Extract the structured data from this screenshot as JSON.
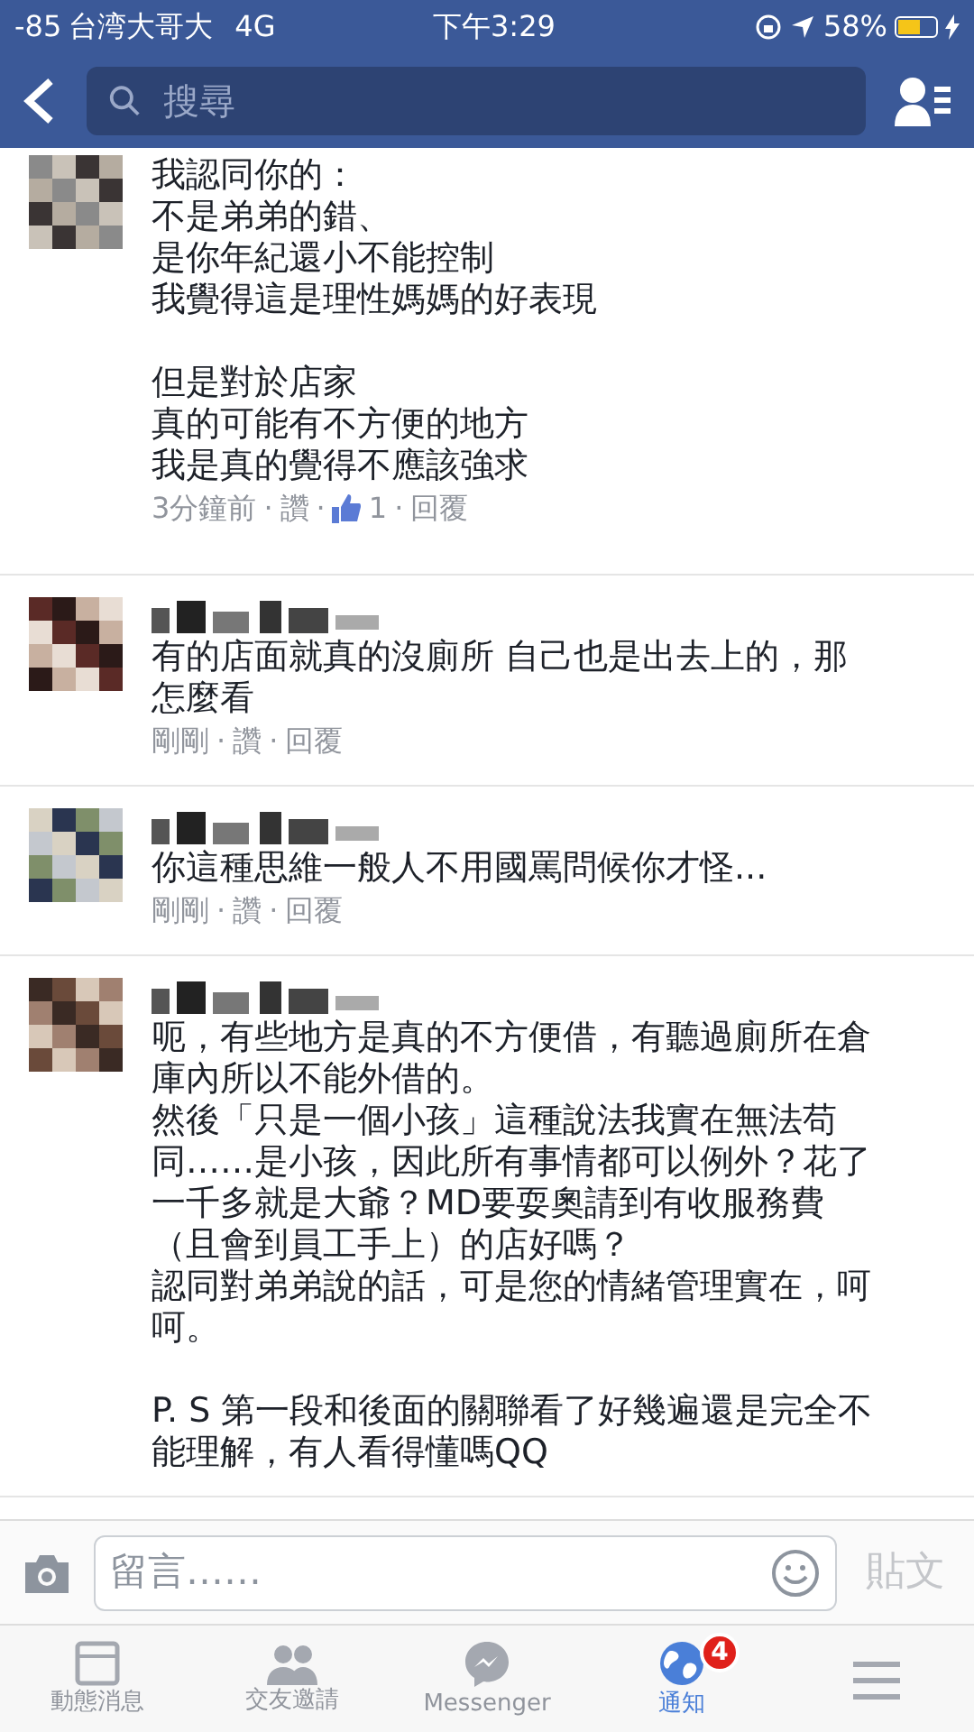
{
  "status_bar": {
    "signal": "-85",
    "carrier": "台湾大哥大",
    "network": "4G",
    "time": "下午3:29",
    "battery": "58%"
  },
  "meta_separator": "·",
  "search": {
    "placeholder": "搜尋"
  },
  "comments": [
    {
      "name": {
        "kind": "cut"
      },
      "paragraphs": [
        [
          "我認同你的：",
          "不是弟弟的錯、",
          "是你年紀還小不能控制",
          "我覺得這是理性媽媽的好表現"
        ],
        [
          "但是對於店家",
          "真的可能有不方便的地方",
          "我是真的覺得不應該強求"
        ]
      ],
      "time": "3分鐘前",
      "like": "讚",
      "likes": "1",
      "reply": "回覆"
    },
    {
      "name": {
        "kind": "blurred"
      },
      "paragraphs": [
        [
          "有的店面就真的沒廁所 自己也是出去上的，那",
          "怎麼看"
        ]
      ],
      "time": "剛剛",
      "like": "讚",
      "reply": "回覆"
    },
    {
      "name": {
        "kind": "blurred"
      },
      "paragraphs": [
        [
          "你這種思維一般人不用國罵問候你才怪..."
        ]
      ],
      "time": "剛剛",
      "like": "讚",
      "reply": "回覆"
    },
    {
      "name": {
        "kind": "blurred"
      },
      "paragraphs": [
        [
          "呃，有些地方是真的不方便借，有聽過廁所在倉",
          "庫內所以不能外借的。",
          "然後「只是一個小孩」這種說法我實在無法苟",
          "同……是小孩，因此所有事情都可以例外？花了",
          "一千多就是大爺？MD要耍奧請到有收服務費",
          "（且會到員工手上）的店好嗎？",
          "認同對弟弟說的話，可是您的情緒管理實在，呵",
          "呵。"
        ],
        [
          "P. S 第一段和後面的關聯看了好幾遍還是完全不",
          "能理解，有人看得懂嗎QQ"
        ]
      ]
    }
  ],
  "composer": {
    "placeholder": "留言……",
    "post": "貼文",
    "post_disabled": true
  },
  "tabs": [
    {
      "kind": "news",
      "label": "動態消息",
      "selected": false
    },
    {
      "kind": "friends",
      "label": "交友邀請",
      "selected": false
    },
    {
      "kind": "messenger",
      "label": "Messenger",
      "selected": false
    },
    {
      "kind": "globe",
      "label": "通知",
      "selected": true,
      "badge": "4"
    },
    {
      "kind": "menu",
      "selected": false
    }
  ]
}
